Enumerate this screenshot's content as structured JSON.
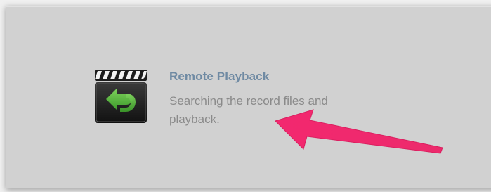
{
  "playback_tile": {
    "title": "Remote Playback",
    "description": "Searching the record files and playback.",
    "icon": "clapperboard-back-arrow-icon"
  },
  "annotation": {
    "icon": "pointer-arrow-icon",
    "color": "#f0286e"
  },
  "colors": {
    "panel_background": "#d1d1d1",
    "title_text": "#6f8aa3",
    "description_text": "#8a8a8a",
    "icon_arrow": "#57b241"
  }
}
